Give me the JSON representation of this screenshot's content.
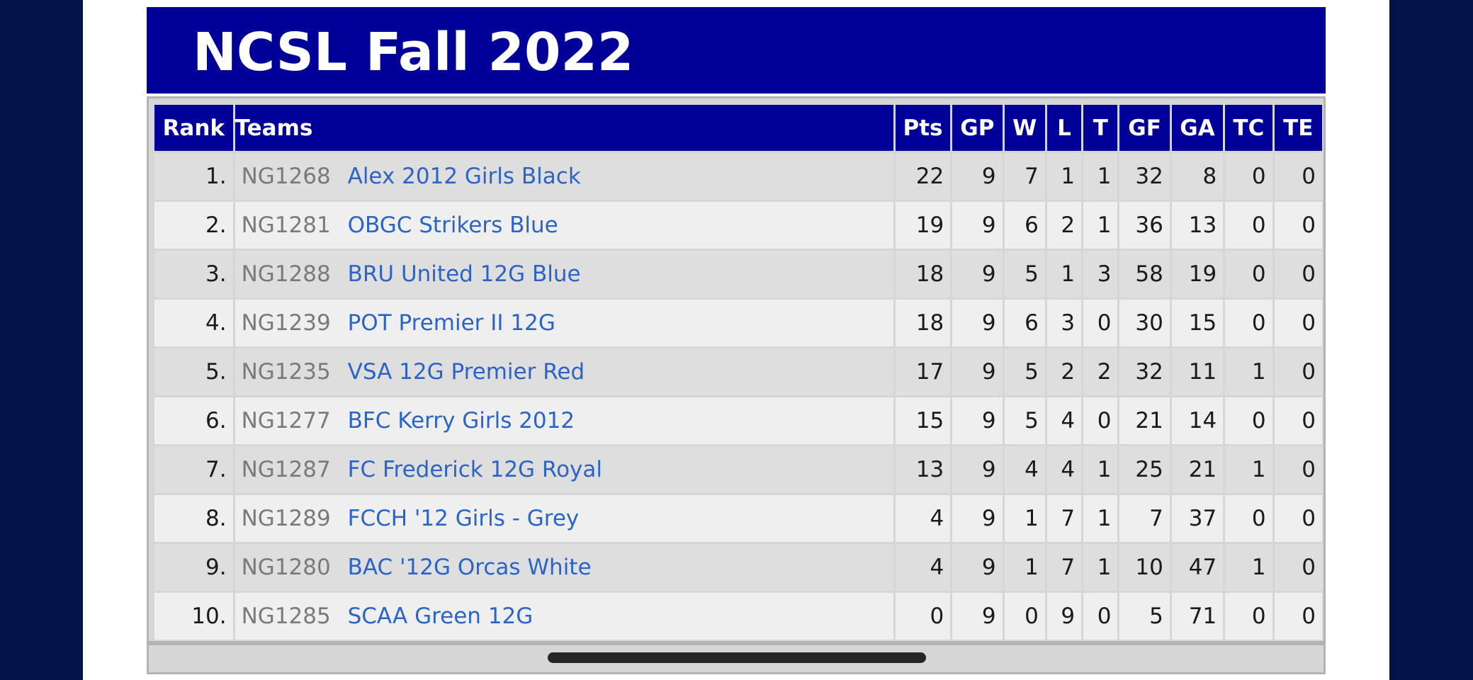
{
  "page_title": "NCSL Fall 2022",
  "headers": [
    "Rank",
    "Teams",
    "Pts",
    "GP",
    "W",
    "L",
    "T",
    "GF",
    "GA",
    "TC",
    "TE"
  ],
  "rows": [
    {
      "rank": "1.",
      "code": "NG1268",
      "team": "Alex 2012 Girls Black",
      "pts": "22",
      "gp": "9",
      "w": "7",
      "l": "1",
      "t": "1",
      "gf": "32",
      "ga": "8",
      "tc": "0",
      "te": "0"
    },
    {
      "rank": "2.",
      "code": "NG1281",
      "team": "OBGC Strikers Blue",
      "pts": "19",
      "gp": "9",
      "w": "6",
      "l": "2",
      "t": "1",
      "gf": "36",
      "ga": "13",
      "tc": "0",
      "te": "0"
    },
    {
      "rank": "3.",
      "code": "NG1288",
      "team": "BRU United 12G Blue",
      "pts": "18",
      "gp": "9",
      "w": "5",
      "l": "1",
      "t": "3",
      "gf": "58",
      "ga": "19",
      "tc": "0",
      "te": "0"
    },
    {
      "rank": "4.",
      "code": "NG1239",
      "team": "POT Premier II 12G",
      "pts": "18",
      "gp": "9",
      "w": "6",
      "l": "3",
      "t": "0",
      "gf": "30",
      "ga": "15",
      "tc": "0",
      "te": "0"
    },
    {
      "rank": "5.",
      "code": "NG1235",
      "team": "VSA 12G Premier Red",
      "pts": "17",
      "gp": "9",
      "w": "5",
      "l": "2",
      "t": "2",
      "gf": "32",
      "ga": "11",
      "tc": "1",
      "te": "0"
    },
    {
      "rank": "6.",
      "code": "NG1277",
      "team": "BFC Kerry Girls 2012",
      "pts": "15",
      "gp": "9",
      "w": "5",
      "l": "4",
      "t": "0",
      "gf": "21",
      "ga": "14",
      "tc": "0",
      "te": "0"
    },
    {
      "rank": "7.",
      "code": "NG1287",
      "team": "FC Frederick 12G Royal",
      "pts": "13",
      "gp": "9",
      "w": "4",
      "l": "4",
      "t": "1",
      "gf": "25",
      "ga": "21",
      "tc": "1",
      "te": "0"
    },
    {
      "rank": "8.",
      "code": "NG1289",
      "team": "FCCH '12 Girls - Grey",
      "pts": "4",
      "gp": "9",
      "w": "1",
      "l": "7",
      "t": "1",
      "gf": "7",
      "ga": "37",
      "tc": "0",
      "te": "0"
    },
    {
      "rank": "9.",
      "code": "NG1280",
      "team": "BAC '12G Orcas White",
      "pts": "4",
      "gp": "9",
      "w": "1",
      "l": "7",
      "t": "1",
      "gf": "10",
      "ga": "47",
      "tc": "1",
      "te": "0"
    },
    {
      "rank": "10.",
      "code": "NG1285",
      "team": "SCAA Green 12G",
      "pts": "0",
      "gp": "9",
      "w": "0",
      "l": "9",
      "t": "0",
      "gf": "5",
      "ga": "71",
      "tc": "0",
      "te": "0"
    }
  ],
  "colors": {
    "outer_background": "#03134a",
    "header_blue": "#000099",
    "team_link": "#2b64c6",
    "row_dark": "#dedede",
    "row_light": "#efefef"
  }
}
